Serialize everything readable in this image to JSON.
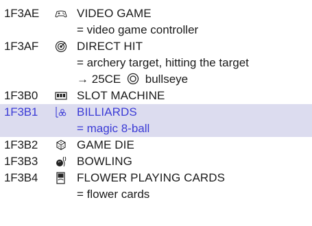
{
  "entries": [
    {
      "code": "1F3AE",
      "name": "VIDEO GAME",
      "icon": "video-game-controller-icon",
      "notes": [
        "= video game controller"
      ]
    },
    {
      "code": "1F3AF",
      "name": "DIRECT HIT",
      "icon": "direct-hit-icon",
      "notes": [
        "= archery target, hitting the target"
      ],
      "xref": {
        "arrow": "→",
        "code": "25CE",
        "icon": "bullseye-icon",
        "name": "bullseye"
      }
    },
    {
      "code": "1F3B0",
      "name": "SLOT MACHINE",
      "icon": "slot-machine-icon",
      "notes": []
    },
    {
      "code": "1F3B1",
      "name": "BILLIARDS",
      "icon": "billiards-icon",
      "notes": [
        "= magic 8-ball"
      ],
      "highlighted": true
    },
    {
      "code": "1F3B2",
      "name": "GAME DIE",
      "icon": "game-die-icon",
      "notes": []
    },
    {
      "code": "1F3B3",
      "name": "BOWLING",
      "icon": "bowling-icon",
      "notes": []
    },
    {
      "code": "1F3B4",
      "name": "FLOWER PLAYING CARDS",
      "icon": "flower-playing-cards-icon",
      "notes": [
        "= flower cards"
      ]
    }
  ],
  "colors": {
    "text": "#1a1a1a",
    "highlight_bg": "#dcdcef",
    "highlight_text": "#3b3bd6"
  }
}
